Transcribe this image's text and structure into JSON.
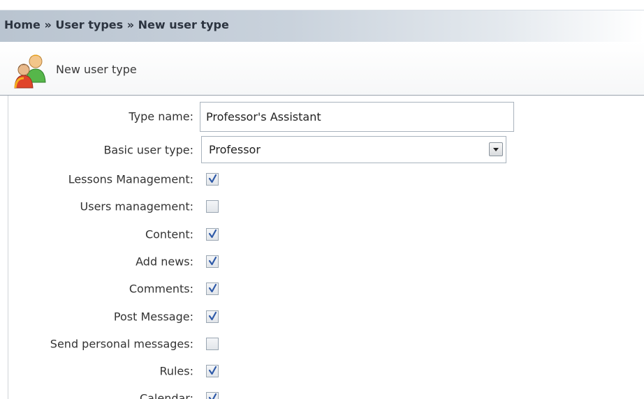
{
  "breadcrumb": {
    "items": [
      "Home",
      "User types",
      "New user type"
    ],
    "separator": "»"
  },
  "title": {
    "text": "New user type",
    "icon": "users-group-icon"
  },
  "form": {
    "type_name_label": "Type name:",
    "type_name_value": "Professor's Assistant",
    "basic_user_type_label": "Basic user type:",
    "basic_user_type_value": "Professor",
    "permissions": [
      {
        "label": "Lessons Management:",
        "checked": true
      },
      {
        "label": "Users management:",
        "checked": false
      },
      {
        "label": "Content:",
        "checked": true
      },
      {
        "label": "Add news:",
        "checked": true
      },
      {
        "label": "Comments:",
        "checked": true
      },
      {
        "label": "Post Message:",
        "checked": true
      },
      {
        "label": "Send personal messages:",
        "checked": false
      },
      {
        "label": "Rules:",
        "checked": true
      },
      {
        "label": "Calendar:",
        "checked": true
      }
    ]
  },
  "colors": {
    "checkmark": "#2f5aa8",
    "header_gradient_start": "#b9c4d0"
  }
}
